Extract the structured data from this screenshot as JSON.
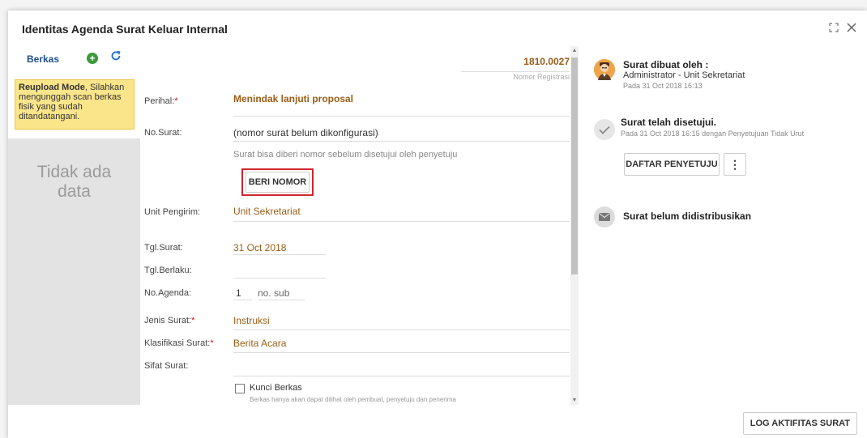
{
  "dialog": {
    "title": "Identitas Agenda Surat Keluar Internal",
    "expand_icon": "expand-icon",
    "close_icon": "close-icon"
  },
  "left": {
    "berkas_label": "Berkas",
    "notice_bold": "Reupload Mode",
    "notice_text": ", Silahkan mengunggah scan berkas fisik yang sudah ditandatangani.",
    "nodata_line1": "Tidak ada",
    "nodata_line2": "data"
  },
  "form": {
    "registration_number": "1810.0027",
    "registration_label": "Nomor Registrasi",
    "perihal_label": "Perihal:",
    "perihal_value": "Menindak lanjuti proposal",
    "nosurat_label": "No.Surat:",
    "nosurat_value": "(nomor surat belum dikonfigurasi)",
    "nosurat_hint": "Surat bisa diberi nomor sebelum disetujui oleh penyetuju",
    "beri_nomor_button": "BERI NOMOR",
    "unit_label": "Unit Pengirim:",
    "unit_value": "Unit Sekretariat",
    "tgl_surat_label": "Tgl.Surat:",
    "tgl_surat_value": "31 Oct 2018",
    "tgl_berlaku_label": "Tgl.Berlaku:",
    "tgl_berlaku_value": "",
    "no_agenda_label": "No.Agenda:",
    "no_agenda_value": "1",
    "no_sub_placeholder": "no. sub",
    "jenis_label": "Jenis Surat:",
    "jenis_value": "Instruksi",
    "klasifikasi_label": "Klasifikasi Surat:",
    "klasifikasi_value": "Berita Acara",
    "sifat_label": "Sifat Surat:",
    "sifat_value": "",
    "kunci_label": "Kunci Berkas",
    "kunci_hint": "Berkas hanya akan dapat dilihat oleh pembuat, penyetuju dan penerima",
    "kunci_checked": false
  },
  "timeline": {
    "created_title": "Surat dibuat oleh :",
    "created_by": "Administrator - Unit Sekretariat",
    "created_at": "Pada 31 Oct 2018 16:13",
    "approved_title": "Surat telah disetujui.",
    "approved_meta": "Pada 31 Oct 2018 16:15 dengan Penyetujuan Tidak Urut",
    "daftar_button": "DAFTAR PENYETUJU",
    "more_icon": "more-vertical-icon",
    "distrib_title": "Surat belum didistribusikan"
  },
  "footer": {
    "log_button": "LOG AKTIFITAS SURAT"
  },
  "colors": {
    "accent_brown": "#9a5d17",
    "notice_yellow": "#fbe58a",
    "highlight_red": "#d0262d",
    "link_blue": "#1f4e8f"
  }
}
